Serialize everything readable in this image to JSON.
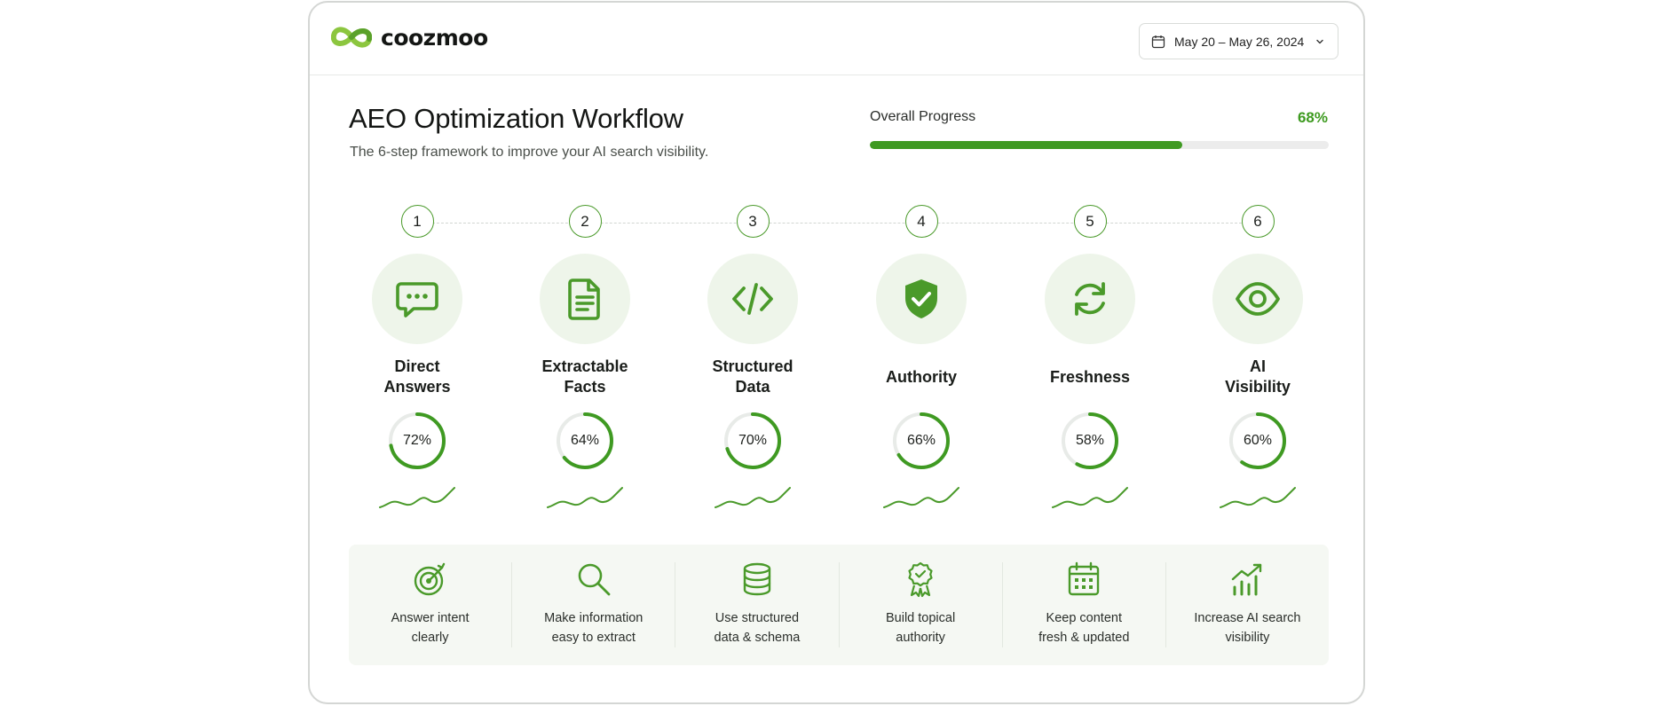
{
  "brand": {
    "name": "coozmoo",
    "accent": "#3f9a22",
    "accent_light": "#8cc63f"
  },
  "date_range": "May 20 – May 26, 2024",
  "header": {
    "title": "AEO Optimization Workflow",
    "subtitle": "The 6-step framework to improve your AI search visibility."
  },
  "progress": {
    "label": "Overall Progress",
    "value_text": "68%",
    "value": 68
  },
  "steps": [
    {
      "number": "1",
      "line1": "Direct",
      "line2": "Answers",
      "icon": "chat-bubble-icon",
      "percent_text": "72%",
      "percent": 72
    },
    {
      "number": "2",
      "line1": "Extractable",
      "line2": "Facts",
      "icon": "document-icon",
      "percent_text": "64%",
      "percent": 64
    },
    {
      "number": "3",
      "line1": "Structured",
      "line2": "Data",
      "icon": "code-icon",
      "percent_text": "70%",
      "percent": 70
    },
    {
      "number": "4",
      "line1": "Authority",
      "line2": "",
      "icon": "shield-check-icon",
      "percent_text": "66%",
      "percent": 66
    },
    {
      "number": "5",
      "line1": "Freshness",
      "line2": "",
      "icon": "refresh-icon",
      "percent_text": "58%",
      "percent": 58
    },
    {
      "number": "6",
      "line1": "AI",
      "line2": "Visibility",
      "icon": "eye-icon",
      "percent_text": "60%",
      "percent": 60
    }
  ],
  "tips": [
    {
      "line1": "Answer intent",
      "line2": "clearly",
      "icon": "target-icon"
    },
    {
      "line1": "Make information",
      "line2": "easy to extract",
      "icon": "magnifier-icon"
    },
    {
      "line1": "Use structured",
      "line2": "data & schema",
      "icon": "database-icon"
    },
    {
      "line1": "Build topical",
      "line2": "authority",
      "icon": "award-badge-icon"
    },
    {
      "line1": "Keep content",
      "line2": "fresh & updated",
      "icon": "calendar-icon"
    },
    {
      "line1": "Increase AI search",
      "line2": "visibility",
      "icon": "growth-chart-icon"
    }
  ]
}
